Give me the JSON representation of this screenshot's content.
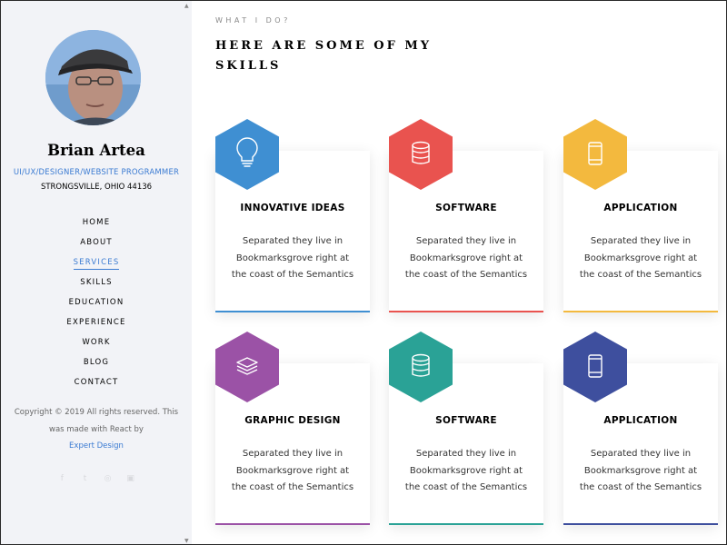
{
  "sidebar": {
    "name": "Brian Artea",
    "role": "UI/UX/DESIGNER/WEBSITE PROGRAMMER",
    "location": "STRONGSVILLE, OHIO 44136",
    "nav": [
      "HOME",
      "ABOUT",
      "SERVICES",
      "SKILLS",
      "EDUCATION",
      "EXPERIENCE",
      "WORK",
      "BLOG",
      "CONTACT"
    ],
    "active_nav": "SERVICES",
    "copyright_line1": "Copyright © 2019 All rights reserved. This",
    "copyright_line2": "was made with React by",
    "copyright_link": "Expert Design",
    "social_icons": [
      "facebook-icon",
      "twitter-icon",
      "instagram-icon",
      "linkedin-icon"
    ]
  },
  "main": {
    "eyebrow": "WHAT I DO?",
    "heading": "HERE ARE SOME OF MY SKILLS",
    "cards": [
      {
        "title": "INNOVATIVE IDEAS",
        "text": "Separated they live in Bookmarksgrove right at the coast of the Semantics",
        "color": "#3f8fd2",
        "icon": "lightbulb-icon"
      },
      {
        "title": "SOFTWARE",
        "text": "Separated they live in Bookmarksgrove right at the coast of the Semantics",
        "color": "#e9534f",
        "icon": "database-icon"
      },
      {
        "title": "APPLICATION",
        "text": "Separated they live in Bookmarksgrove right at the coast of the Semantics",
        "color": "#f3b93e",
        "icon": "mobile-icon"
      },
      {
        "title": "GRAPHIC DESIGN",
        "text": "Separated they live in Bookmarksgrove right at the coast of the Semantics",
        "color": "#9b52a6",
        "icon": "layers-icon"
      },
      {
        "title": "SOFTWARE",
        "text": "Separated they live in Bookmarksgrove right at the coast of the Semantics",
        "color": "#2aa296",
        "icon": "database-icon"
      },
      {
        "title": "APPLICATION",
        "text": "Separated they live in Bookmarksgrove right at the coast of the Semantics",
        "color": "#3e4f9e",
        "icon": "mobile-icon"
      }
    ]
  }
}
